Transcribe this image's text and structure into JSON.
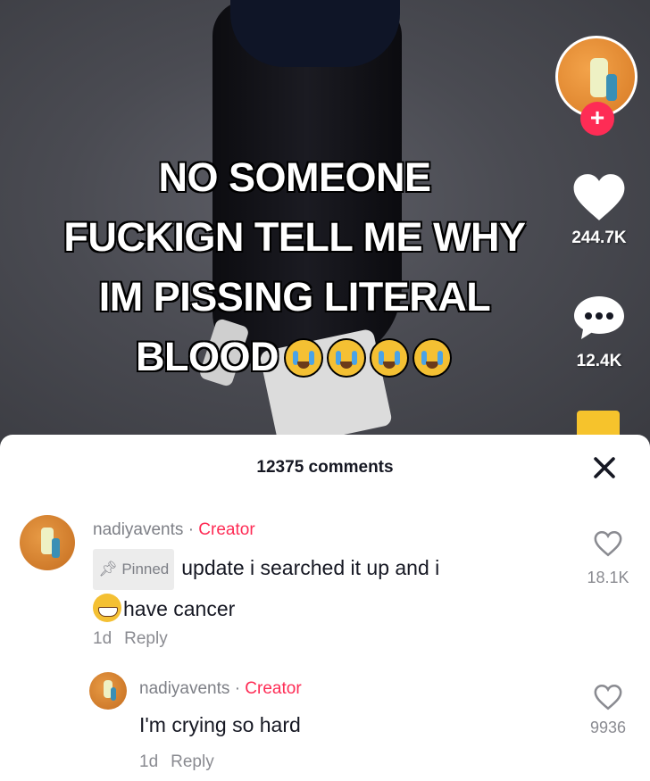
{
  "video": {
    "overlay_lines": [
      "NO SOMEONE",
      "FUCKIGN TELL ME WHY",
      "IM PISSING LITERAL",
      "BLOOD"
    ],
    "emoji_names": [
      "loudly-crying-face",
      "loudly-crying-face",
      "loudly-crying-face",
      "loudly-crying-face"
    ]
  },
  "rail": {
    "likes": "244.7K",
    "comments": "12.4K",
    "follow_icon": "plus-icon",
    "accent": "#fe2c55"
  },
  "panel": {
    "title": "12375 comments",
    "close_icon": "close-icon"
  },
  "comments": [
    {
      "username": "nadiyavents",
      "separator": "·",
      "badge": "Creator",
      "pinned_label": "Pinned",
      "text_line1": "update i searched it up and i",
      "text_line2": "have cancer",
      "emoji": "grinning-face",
      "time": "1d",
      "reply_label": "Reply",
      "likes": "18.1K"
    },
    {
      "username": "nadiyavents",
      "separator": "·",
      "badge": "Creator",
      "text": "I'm crying so hard",
      "time": "1d",
      "reply_label": "Reply",
      "likes": "9936"
    }
  ]
}
